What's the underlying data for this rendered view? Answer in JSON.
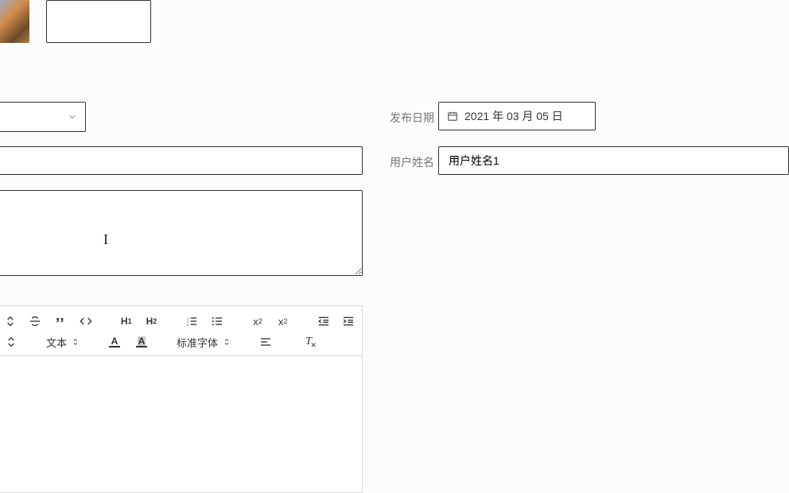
{
  "form": {
    "publish_date_label": "发布日期",
    "publish_date_value": "2021 年 03 月 05 日",
    "username_label": "用户姓名",
    "username_value": "用户姓名1",
    "line_value": "",
    "textarea_value": ""
  },
  "editor": {
    "font_family_label": "文本",
    "font_size_label": "标准字体"
  }
}
